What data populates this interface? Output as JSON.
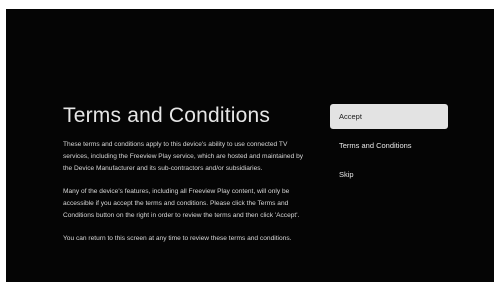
{
  "page": {
    "title": "Terms and Conditions",
    "paragraphs": [
      "These terms and conditions apply to this device's ability to use connected TV services, including the Freeview Play service, which are hosted and maintained by the Device Manufacturer and its sub-contractors and/or subsidiaries.",
      "Many of the device's features, including all Freeview Play content, will only be accessible if you accept the terms and conditions. Please click the Terms and Conditions button on the right in order to review the terms and then click 'Accept'.",
      "You can return to this screen at any time to review these terms and conditions."
    ]
  },
  "menu": {
    "items": [
      {
        "label": "Accept",
        "selected": true
      },
      {
        "label": "Terms and Conditions",
        "selected": false
      },
      {
        "label": "Skip",
        "selected": false
      }
    ]
  },
  "colors": {
    "background": "#050505",
    "text": "#e6e6e6",
    "selected_background": "#e3e3e3",
    "selected_text": "#1a1a1a"
  }
}
